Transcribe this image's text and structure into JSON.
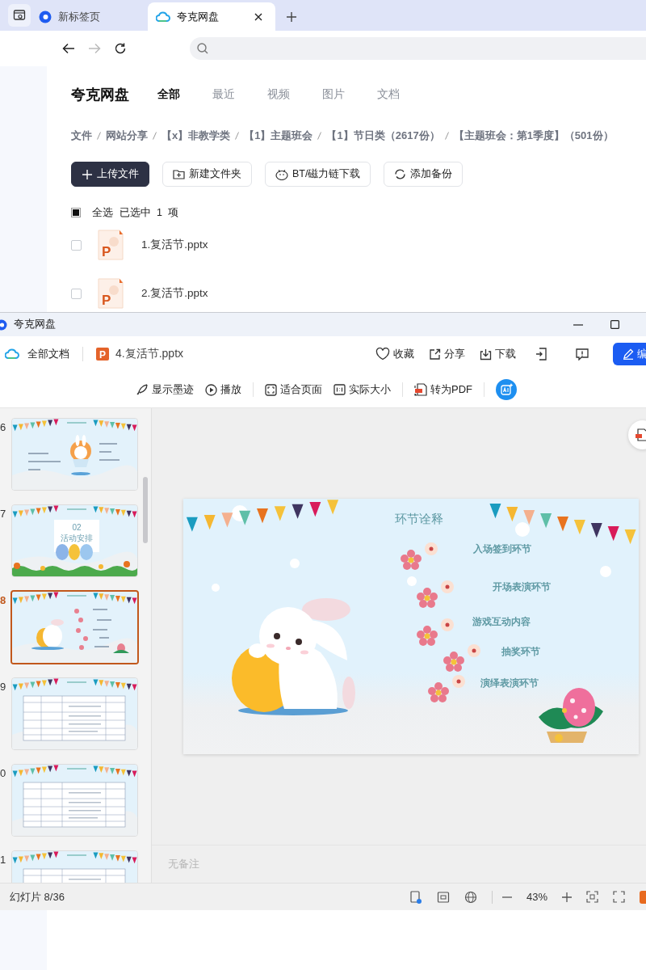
{
  "browser": {
    "tabs": [
      {
        "title": "新标签页",
        "selected": false
      },
      {
        "title": "夸克网盘",
        "selected": true
      }
    ]
  },
  "drive": {
    "brand": "夸克网盘",
    "tabs": [
      {
        "label": "全部",
        "selected": true
      },
      {
        "label": "最近",
        "selected": false
      },
      {
        "label": "视频",
        "selected": false
      },
      {
        "label": "图片",
        "selected": false
      },
      {
        "label": "文档",
        "selected": false
      }
    ],
    "breadcrumb": [
      "文件",
      "网站分享",
      "【x】非教学类",
      "【1】主题班会",
      "【1】节日类（2617份）",
      "【主题班会：第1季度】（501份）"
    ],
    "actions": [
      {
        "label": "上传文件",
        "kind": "upload"
      },
      {
        "label": "新建文件夹",
        "kind": "folder"
      },
      {
        "label": "BT/磁力链下载",
        "kind": "bt"
      },
      {
        "label": "添加备份",
        "kind": "backup"
      }
    ],
    "select_all": {
      "label": "全选",
      "indeterminate": true,
      "summary": "已选中  1  项"
    },
    "files": [
      {
        "name": "1.复活节.pptx",
        "icon_letter": "P",
        "checked": false
      },
      {
        "name": "2.复活节.pptx",
        "icon_letter": "P",
        "checked": false
      }
    ]
  },
  "viewer": {
    "title": "夸克网盘",
    "root": "全部文档",
    "file": "4.复活节.pptx",
    "file_icon_letter": "P",
    "actions": [
      {
        "label": "收藏",
        "kind": "heart"
      },
      {
        "label": "分享",
        "kind": "share"
      },
      {
        "label": "下载",
        "kind": "download"
      }
    ],
    "edit": "编",
    "tool_groups": [
      [
        {
          "label": "显示墨迹",
          "kind": "ink"
        },
        {
          "label": "播放",
          "kind": "play"
        }
      ],
      [
        {
          "label": "适合页面",
          "kind": "fit"
        },
        {
          "label": "实际大小",
          "kind": "actual"
        }
      ],
      [
        {
          "label": "转为PDF",
          "kind": "pdf"
        }
      ]
    ],
    "slides": [
      {
        "number": "6",
        "selected": false,
        "kind": "intro"
      },
      {
        "number": "7",
        "selected": false,
        "kind": "section",
        "texts": [
          "02",
          "活动安排"
        ]
      },
      {
        "number": "8",
        "selected": true,
        "kind": "bunny"
      },
      {
        "number": "9",
        "selected": false,
        "kind": "table"
      },
      {
        "number": "0",
        "selected": false,
        "kind": "table"
      },
      {
        "number": "1",
        "selected": false,
        "kind": "table"
      }
    ],
    "slide": {
      "title": "环节诠释",
      "items": [
        "入场签到环节",
        "开场表演环节",
        "游戏互动内容",
        "抽奖环节",
        "演绎表演环节"
      ]
    },
    "notes": "无备注",
    "status": {
      "position": "幻灯片 8/36",
      "zoom": "43%"
    }
  }
}
